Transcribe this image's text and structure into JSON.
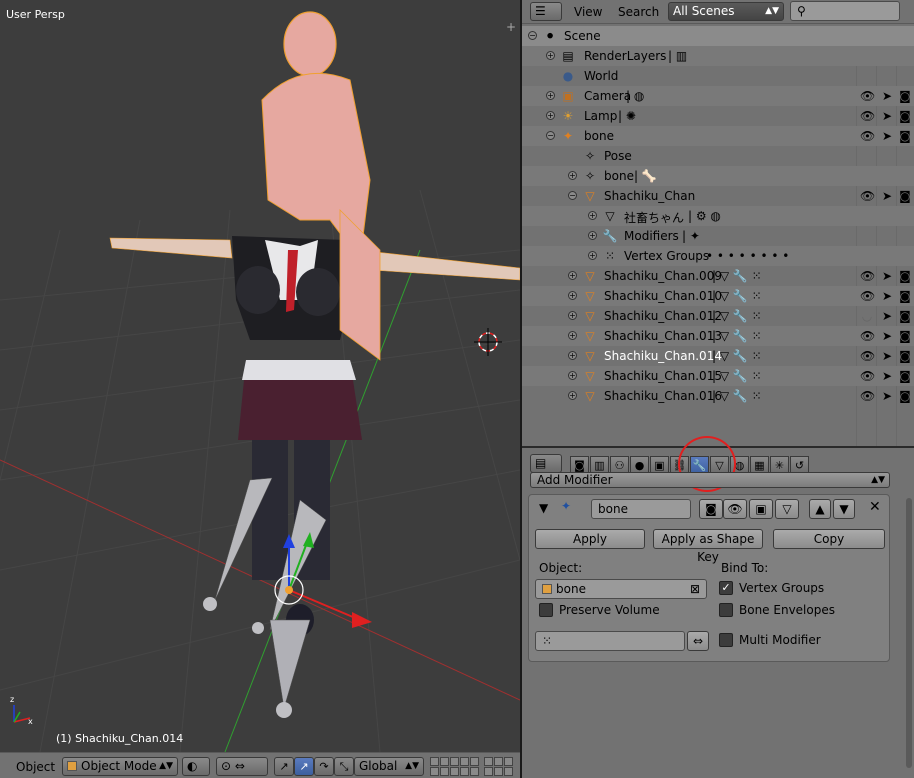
{
  "viewport": {
    "view_label": "User Persp",
    "active_object": "(1) Shachiku_Chan.014",
    "corner_icon": "+"
  },
  "view3d_header": {
    "menu_label": "Object",
    "mode": "Object Mode",
    "orientation": "Global"
  },
  "outliner": {
    "view_menu": "View",
    "search_menu": "Search",
    "scenes_dropdown": "All Scenes",
    "search_placeholder": "",
    "rows": [
      {
        "label": "Scene"
      },
      {
        "label": "RenderLayers"
      },
      {
        "label": "World"
      },
      {
        "label": "Camera"
      },
      {
        "label": "Lamp"
      },
      {
        "label": "bone"
      },
      {
        "label": "Pose"
      },
      {
        "label": "bone"
      },
      {
        "label": "Shachiku_Chan"
      },
      {
        "label": "社畜ちゃん"
      },
      {
        "label": "Modifiers"
      },
      {
        "label": "Vertex Groups"
      },
      {
        "label": "Shachiku_Chan.009"
      },
      {
        "label": "Shachiku_Chan.010"
      },
      {
        "label": "Shachiku_Chan.012"
      },
      {
        "label": "Shachiku_Chan.013"
      },
      {
        "label": "Shachiku_Chan.014"
      },
      {
        "label": "Shachiku_Chan.015"
      },
      {
        "label": "Shachiku_Chan.016"
      }
    ],
    "vertex_groups_dots": "•  •  •  •  •  •  •  •"
  },
  "properties": {
    "add_modifier": "Add Modifier",
    "modifier_name": "bone",
    "apply": "Apply",
    "apply_shape": "Apply as Shape Key",
    "copy": "Copy",
    "object_label": "Object:",
    "object_value": "bone",
    "bind_to": "Bind To:",
    "vertex_groups": "Vertex Groups",
    "bone_envelopes": "Bone Envelopes",
    "preserve_volume": "Preserve Volume",
    "multi_modifier": "Multi Modifier",
    "vertex_group_field": "",
    "checks": {
      "vertex_groups": true,
      "bone_envelopes": false,
      "preserve_volume": false,
      "multi_modifier": false
    }
  },
  "colors": {
    "viewport_bg": "#3d3d3d",
    "panel_bg": "#727272",
    "selection_orange": "#f0a030",
    "annotation_red": "#e02020"
  }
}
